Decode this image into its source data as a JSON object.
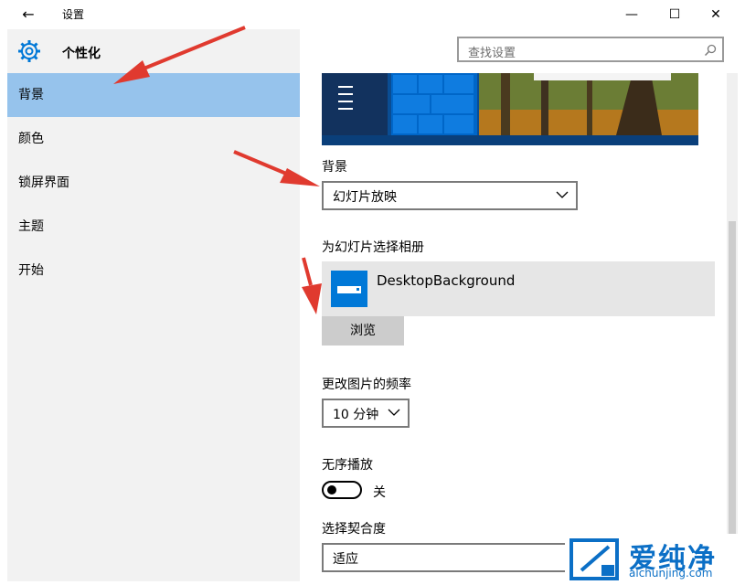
{
  "window": {
    "title": "设置",
    "back_glyph": "←",
    "minimize_glyph": "—",
    "maximize_glyph": "☐",
    "close_glyph": "✕"
  },
  "sidebar": {
    "header": "个性化",
    "header_icon": "gear-icon",
    "items": [
      {
        "label": "背景",
        "selected": true
      },
      {
        "label": "颜色",
        "selected": false
      },
      {
        "label": "锁屏界面",
        "selected": false
      },
      {
        "label": "主题",
        "selected": false
      },
      {
        "label": "开始",
        "selected": false
      }
    ]
  },
  "search": {
    "placeholder": "查找设置",
    "icon": "search-icon"
  },
  "main": {
    "background_label": "背景",
    "background_value": "幻灯片放映",
    "album_label": "为幻灯片选择相册",
    "album_name": "DesktopBackground",
    "browse_label": "浏览",
    "frequency_label": "更改图片的频率",
    "frequency_value": "10 分钟",
    "shuffle_label": "无序播放",
    "shuffle_state": "关",
    "shuffle_on": false,
    "fit_label": "选择契合度",
    "fit_value": "适应"
  },
  "watermark": {
    "name": "爱纯净",
    "url": "aichunjing.com"
  },
  "colors": {
    "accent": "#0078d7",
    "selected_nav": "#96c3ec",
    "sidebar_bg": "#f2f2f2",
    "annotation_arrow": "#e03a2f"
  }
}
